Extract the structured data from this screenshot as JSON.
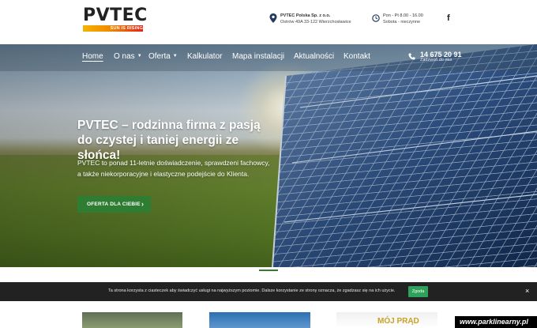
{
  "logo": {
    "name": "PVTEC",
    "tagline": "SUN IS RISING"
  },
  "header": {
    "address": {
      "company": "PVTEC Polska Sp. z o.o.",
      "street": "Ostrów 49A 33-122 Wierzchosławice"
    },
    "hours": {
      "weekdays": "Pon - Pt 8.00 - 16.00",
      "saturday": "Sobota - nieczynne"
    },
    "social": {
      "facebook_glyph": "f"
    }
  },
  "nav": {
    "items": [
      {
        "label": "Home",
        "active": true
      },
      {
        "label": "O nas",
        "has_dropdown": true
      },
      {
        "label": "Oferta",
        "has_dropdown": true
      },
      {
        "label": "Kalkulator"
      },
      {
        "label": "Mapa instalacji"
      },
      {
        "label": "Aktualności"
      },
      {
        "label": "Kontakt"
      }
    ],
    "phone": {
      "number": "14 675 20 91",
      "label": "Zadzwoń do nas"
    }
  },
  "hero": {
    "title": "PVTEC – rodzinna firma z pasją do czystej i taniej energii ze słońca!",
    "text": "PVTEC to ponad 11-letnie doświadczenie, sprawdzeni fachowcy, a także niekorporacyjne i elastyczne podejście do Klienta.",
    "cta_label": "OFERTA DLA CIEBIE",
    "cta_arrow": "›"
  },
  "cookie": {
    "text": "Ta strona korzysta z ciasteczek aby świadczyć usługi na najwyższym poziomie. Dalsze korzystanie ze strony oznacza, że zgadzasz się na ich użycie.",
    "accept": "Zgoda",
    "close": "×"
  },
  "cards": {
    "third_label": "MÓJ PRĄD"
  },
  "watermark": "www.parklinearny.pl",
  "colors": {
    "primary": "#2e7d32",
    "cookie_bg": "#222222",
    "accept": "#2ea15a"
  }
}
